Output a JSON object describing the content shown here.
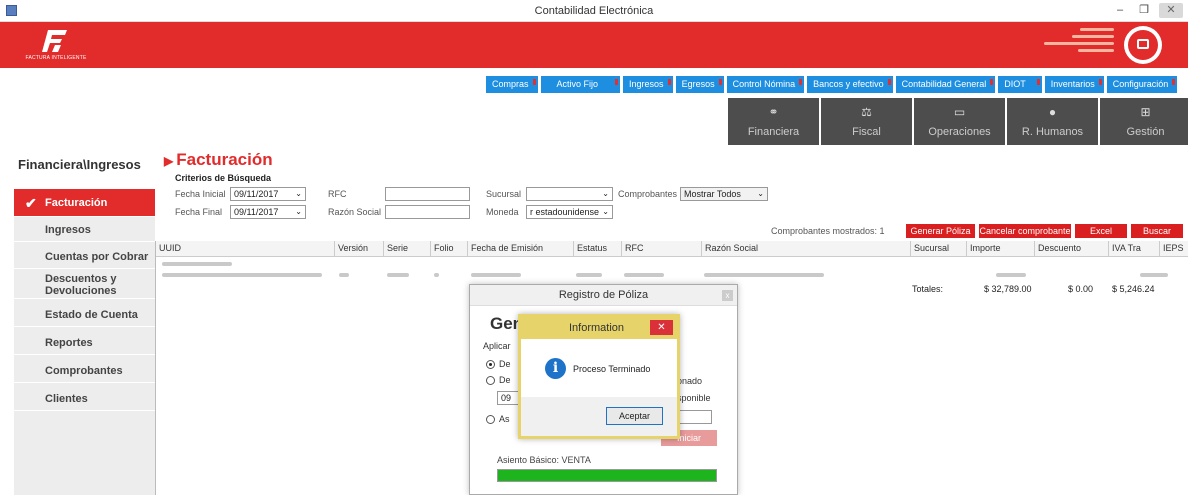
{
  "window": {
    "title": "Contabilidad Electrónica",
    "controls": {
      "minimize": "–",
      "maximize": "❐",
      "close": "✕"
    }
  },
  "header": {
    "logo_text": "FACTURA INTELIGENTE"
  },
  "top_menu": [
    {
      "label": "Compras",
      "pinned": true
    },
    {
      "label": "Activo Fijo",
      "pinned": true
    },
    {
      "label": "Ingresos",
      "pinned": true
    },
    {
      "label": "Egresos",
      "pinned": true
    },
    {
      "label": "Control Nómina",
      "pinned": true
    },
    {
      "label": "Bancos y efectivo",
      "pinned": true
    },
    {
      "label": "Contabilidad General",
      "pinned": true
    },
    {
      "label": "DIOT",
      "pinned": true
    },
    {
      "label": "Inventarios",
      "pinned": true
    },
    {
      "label": "Configuración",
      "pinned": true
    }
  ],
  "tiles": [
    {
      "label": "Financiera",
      "icon": "coins-icon"
    },
    {
      "label": "Fiscal",
      "icon": "scale-icon"
    },
    {
      "label": "Operaciones",
      "icon": "clipboard-icon"
    },
    {
      "label": "R. Humanos",
      "icon": "person-icon"
    },
    {
      "label": "Gestión",
      "icon": "org-chart-icon"
    }
  ],
  "breadcrumb": "Financiera\\Ingresos",
  "sidebar": [
    {
      "label": "Facturación",
      "active": true
    },
    {
      "label": "Ingresos"
    },
    {
      "label": "Cuentas por Cobrar"
    },
    {
      "label": "Descuentos y Devoluciones"
    },
    {
      "label": "Estado de Cuenta"
    },
    {
      "label": "Reportes"
    },
    {
      "label": "Comprobantes"
    },
    {
      "label": "Clientes"
    }
  ],
  "page_title": "Facturación",
  "criteria": {
    "heading": "Criterios de Búsqueda",
    "fecha_inicial_label": "Fecha Inicial",
    "fecha_inicial": "09/11/2017",
    "fecha_final_label": "Fecha Final",
    "fecha_final": "09/11/2017",
    "rfc_label": "RFC",
    "rfc": "",
    "razon_social_label": "Razón Social",
    "razon_social": "",
    "sucursal_label": "Sucursal",
    "sucursal": "",
    "moneda_label": "Moneda",
    "moneda": "r estadounidense",
    "comprobantes_label": "Comprobantes",
    "comprobantes": "Mostrar Todos"
  },
  "actions": {
    "shown": "Comprobantes mostrados: 1",
    "generar": "Generar Póliza",
    "cancelar": "Cancelar comprobante",
    "excel": "Excel",
    "buscar": "Buscar"
  },
  "grid": {
    "columns": [
      "UUID",
      "Versión",
      "Serie",
      "Folio",
      "Fecha de Emisión",
      "Estatus",
      "RFC",
      "Razón Social",
      "Sucursal",
      "Importe",
      "Descuento",
      "IVA Tra",
      "IEPS"
    ],
    "totals_label": "Totales:",
    "totals": {
      "importe": "$ 32,789.00",
      "descuento": "$ 0.00",
      "iva": "$ 5,246.24"
    }
  },
  "registro_dialog": {
    "title": "Registro de Póliza",
    "close": "x",
    "heading": "Generación de Póliza",
    "aplicar_label": "Aplicar",
    "options": [
      "De",
      "De",
      "As"
    ],
    "selected_option": 0,
    "text_fragments": {
      "seleccionado": "ionado",
      "disponible": "isponible",
      "field_prefix": "09"
    },
    "iniciar": "Iniciar",
    "asiento": "Asiento Básico: VENTA",
    "progress": 1.0
  },
  "info_dialog": {
    "title": "Information",
    "close": "✕",
    "message": "Proceso Terminado",
    "icon": "info-icon",
    "ok": "Aceptar"
  },
  "colors": {
    "brand_red": "#e22b2b",
    "menu_blue": "#1e8fe0",
    "tile_gray": "#4d4d4d",
    "progress_green": "#1db41d",
    "info_gold": "#e6d46a"
  }
}
